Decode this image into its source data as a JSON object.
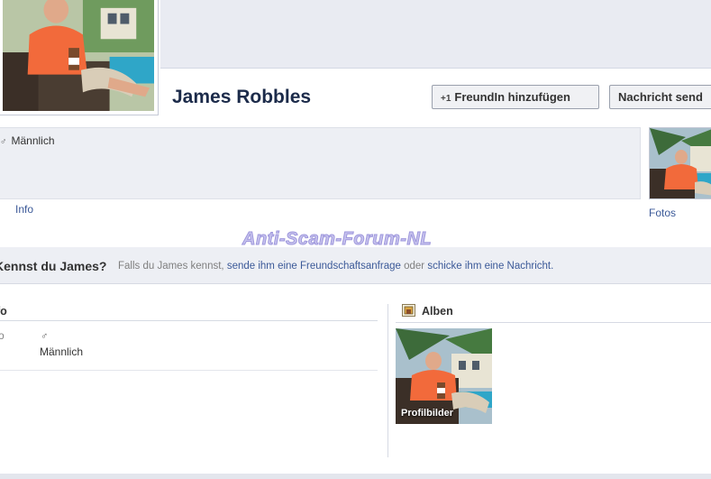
{
  "profile": {
    "name": "James Robbles",
    "gender": "Männlich",
    "gender_symbol": "♂"
  },
  "actions": {
    "add_friend_icon": "+1",
    "add_friend_label": "FreundIn hinzufügen",
    "message_label": "Nachricht send"
  },
  "nav": {
    "info_link": "Info",
    "fotos_link": "Fotos"
  },
  "watermark": "Anti-Scam-Forum-NL",
  "know_bar": {
    "title": "Kennst du James?",
    "prefix": "Falls du James kennst,",
    "link_request": "sende ihm eine Freundschaftsanfrage",
    "middle": "oder",
    "link_message": "schicke ihm eine Nachricht",
    "suffix": "."
  },
  "info_section": {
    "title": "fo",
    "row_label": "fo",
    "gender_symbol": "♂",
    "gender_value": "Männlich"
  },
  "albums_section": {
    "title": "Alben",
    "albums": [
      {
        "label": "Profilbilder"
      }
    ]
  },
  "colors": {
    "link": "#3b5998",
    "name": "#1c2b4a",
    "panel_bg": "#edeff4",
    "shirt": "#f26a3b",
    "watermark": "#c7c3ee"
  },
  "icons": {
    "album_icon": "photo-album-icon",
    "gender_icon": "male-icon",
    "add_friend_icon": "add-friend-icon"
  }
}
